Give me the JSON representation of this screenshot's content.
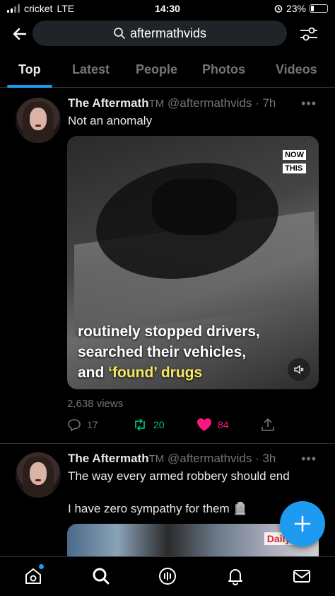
{
  "status_bar": {
    "carrier": "cricket",
    "network": "LTE",
    "time": "14:30",
    "battery": "23%",
    "battery_level": 0.23
  },
  "search": {
    "query": "aftermathvids"
  },
  "tabs": [
    {
      "label": "Top",
      "active": true
    },
    {
      "label": "Latest",
      "active": false
    },
    {
      "label": "People",
      "active": false
    },
    {
      "label": "Photos",
      "active": false
    },
    {
      "label": "Videos",
      "active": false
    }
  ],
  "tweets": [
    {
      "name": "The Aftermath",
      "badge": "TM",
      "handle": "@aftermathvids",
      "time": "· 7h",
      "text": "Not an anomaly",
      "media": {
        "tag_line1": "NOW",
        "tag_line2": "THIS",
        "caption_line1": "routinely stopped drivers,",
        "caption_line2": "searched their vehicles,",
        "caption_line3_prefix": "and ",
        "caption_line3_highlight": "‘found’ drugs"
      },
      "views": "2,638 views",
      "replies": "17",
      "retweets": "20",
      "likes": "84"
    },
    {
      "name": "The Aftermath",
      "badge": "TM",
      "handle": "@aftermathvids",
      "time": "· 3h",
      "text_line1": "The way every armed robbery should end",
      "text_line2": "I have zero sympathy for them 🪦",
      "media_tag": "Daily Ca"
    }
  ],
  "colors": {
    "accent": "#1d9bf0",
    "like": "#f91880",
    "retweet": "#00ba7c",
    "muted": "#71767b"
  },
  "icons": [
    "back-arrow-icon",
    "search-icon",
    "filter-icon",
    "more-icon",
    "reply-icon",
    "retweet-icon",
    "heart-icon",
    "share-icon",
    "mute-icon",
    "plus-icon",
    "home-icon",
    "explore-icon",
    "spaces-icon",
    "bell-icon",
    "mail-icon"
  ]
}
